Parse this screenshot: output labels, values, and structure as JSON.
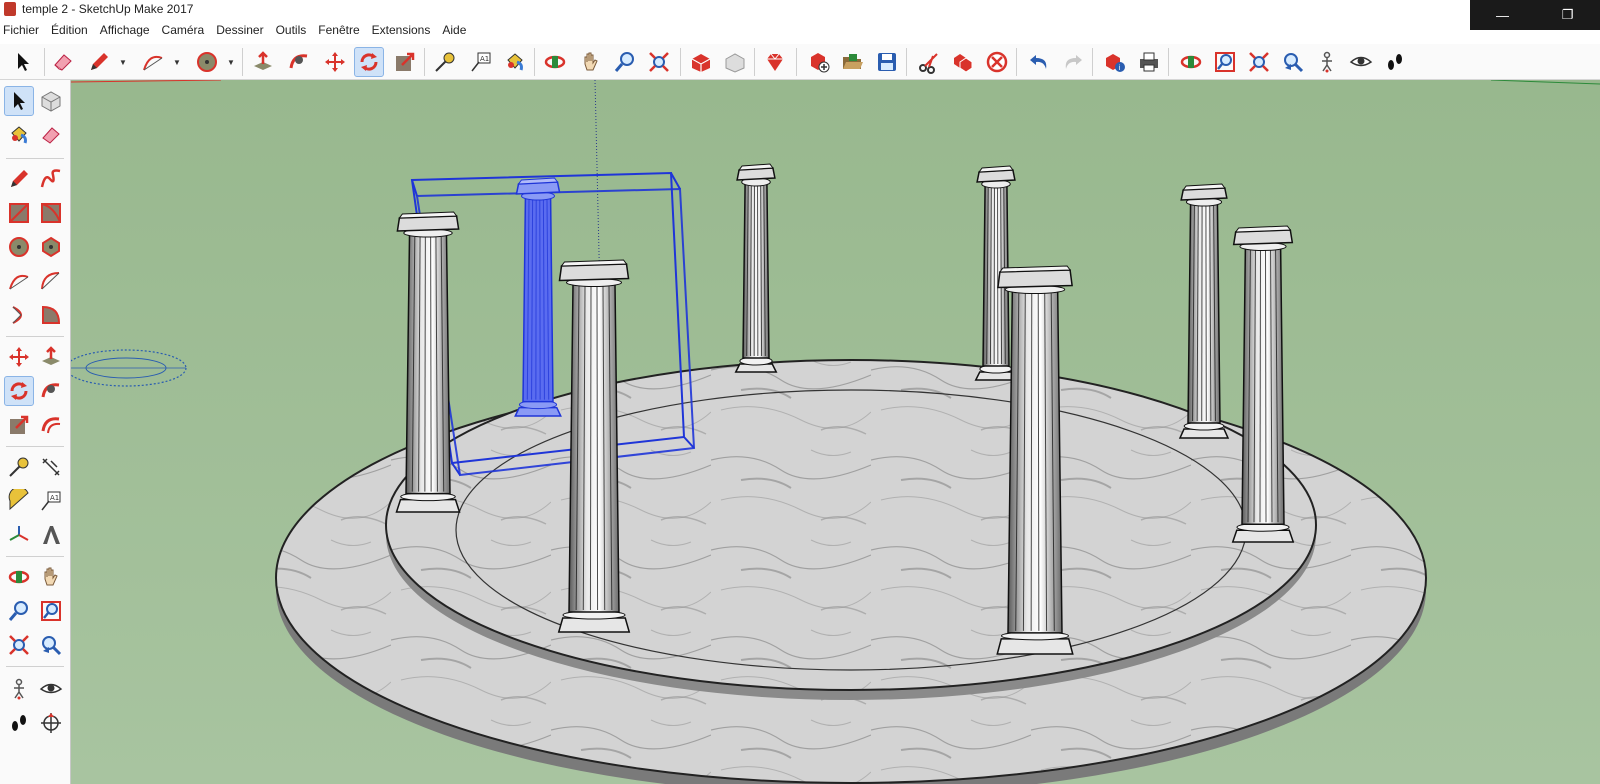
{
  "window": {
    "title": "temple 2 - SketchUp Make 2017",
    "minimize_glyph": "—",
    "restore_glyph": "❐"
  },
  "menu": [
    "Fichier",
    "Édition",
    "Affichage",
    "Caméra",
    "Dessiner",
    "Outils",
    "Fenêtre",
    "Extensions",
    "Aide"
  ],
  "toolbar": {
    "active_tool": "rotate",
    "tools": [
      "select",
      "eraser",
      "pencil",
      "arc",
      "circle",
      "push-pull",
      "follow-me",
      "move",
      "rotate",
      "scale",
      "tape-measure",
      "text",
      "paint-bucket",
      "orbit",
      "pan",
      "zoom",
      "zoom-extents",
      "3d-warehouse",
      "extension-warehouse",
      "extension-manager",
      "new-model",
      "open",
      "save",
      "cut",
      "copy",
      "delete",
      "undo",
      "redo",
      "model-info",
      "print",
      "orbit",
      "zoom-window",
      "zoom-extents",
      "previous-view",
      "position-camera",
      "look-around",
      "walk"
    ]
  },
  "left_toolbar": {
    "active_tool": "rotate"
  },
  "colors": {
    "sky": "#98b88e",
    "selection": "#1f35d8",
    "marble": "#cfcfcf",
    "toolbar_bg": "#fafafa",
    "accent_red": "#d9332b"
  }
}
